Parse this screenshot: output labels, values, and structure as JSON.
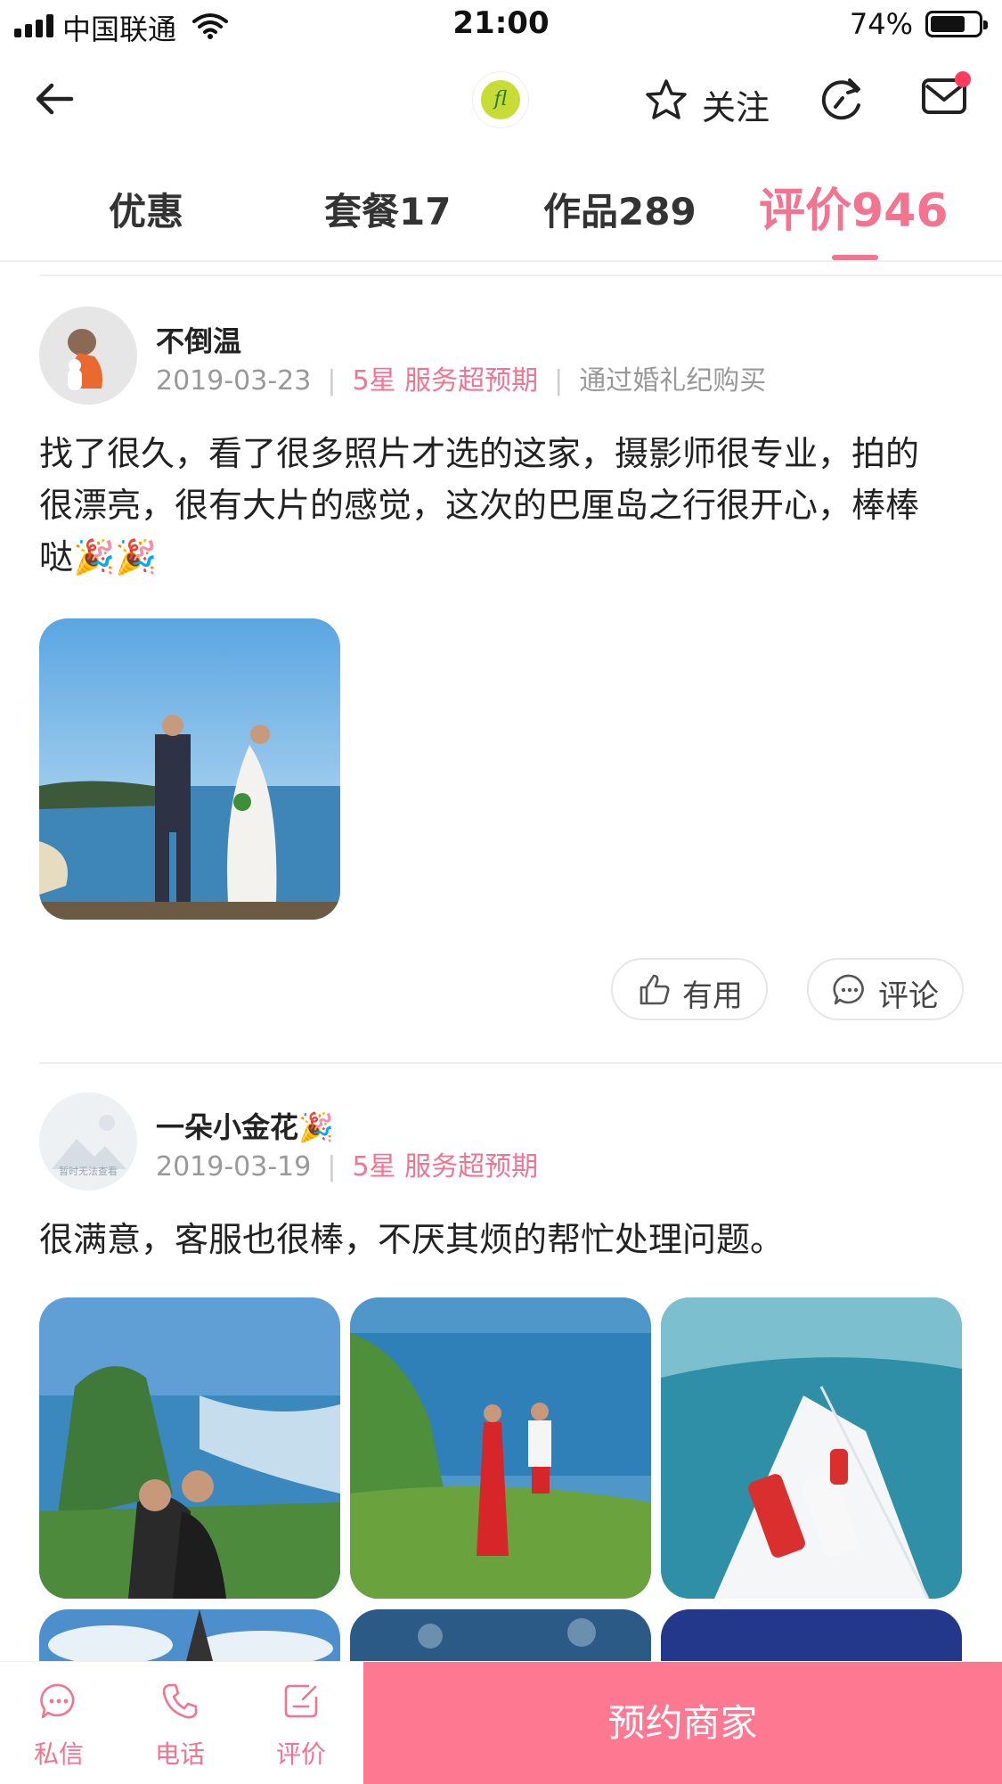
{
  "status_bar": {
    "carrier": "中国联通",
    "time": "21:00",
    "battery_percent": "74%",
    "battery_level": 0.74
  },
  "nav": {
    "logo_text": "fl",
    "follow_label": "关注",
    "icons": [
      "back-arrow-icon",
      "star-icon",
      "refresh-icon",
      "mail-icon"
    ]
  },
  "tabs": [
    {
      "label": "优惠"
    },
    {
      "label": "套餐17"
    },
    {
      "label": "作品289"
    },
    {
      "label": "评价946",
      "active": true
    }
  ],
  "reviews": [
    {
      "username": "不倒温",
      "date": "2019-03-23",
      "rating": "5星 服务超预期",
      "source": "通过婚礼纪购买",
      "text": "找了很久，看了很多照片才选的这家，摄影师很专业，拍的很漂亮，很有大片的感觉，这次的巴厘岛之行很开心，棒棒哒🎉🎉",
      "actions": {
        "useful": "有用",
        "comment": "评论"
      }
    },
    {
      "username": "一朵小金花🎉",
      "date": "2019-03-19",
      "rating": "5星 服务超预期",
      "avatar_placeholder": "暂时无法查看",
      "text": "很满意，客服也很棒，不厌其烦的帮忙处理问题。"
    }
  ],
  "bottom_bar": {
    "message": "私信",
    "phone": "电话",
    "review": "评价",
    "book": "预约商家"
  },
  "colors": {
    "accent": "#f27491",
    "book_button": "#ff7891",
    "notification_dot": "#ff3a5c"
  }
}
